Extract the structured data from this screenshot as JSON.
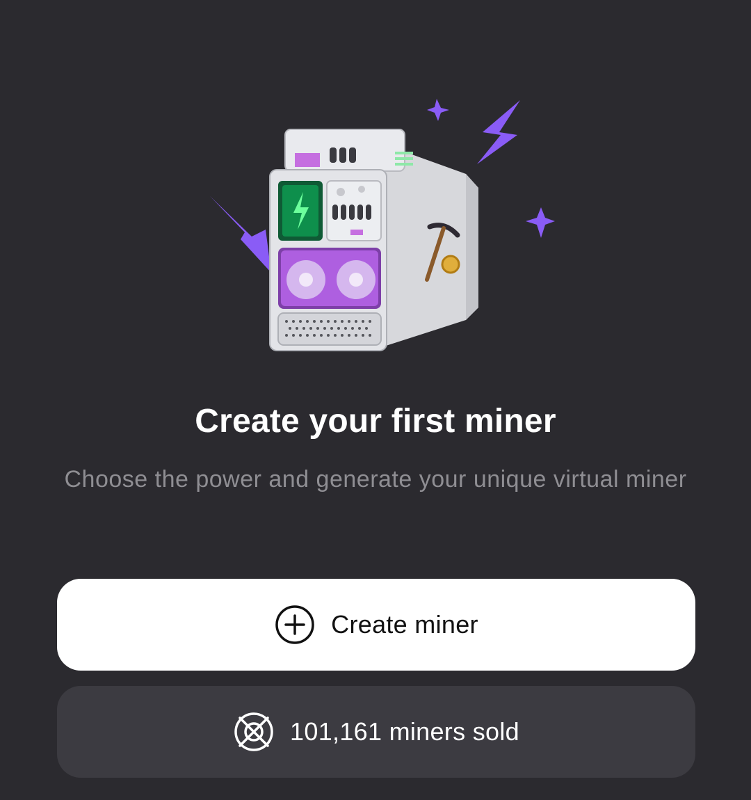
{
  "hero": {
    "image": "virtual-miner-machine",
    "accent_color": "#8a5cf6",
    "screen_color": "#0e8f4c"
  },
  "title": "Create your first miner",
  "subtitle": "Choose the power and generate your unique virtual miner",
  "actions": {
    "create_label": "Create miner",
    "create_icon": "plus-circle-icon",
    "sold_label": "101,161 miners sold",
    "sold_icon": "miner-crossed-circle-icon"
  },
  "colors": {
    "background": "#2b2a2f",
    "primary_button": "#ffffff",
    "secondary_button": "#3c3b41",
    "subtitle_text": "#8f8e93"
  }
}
